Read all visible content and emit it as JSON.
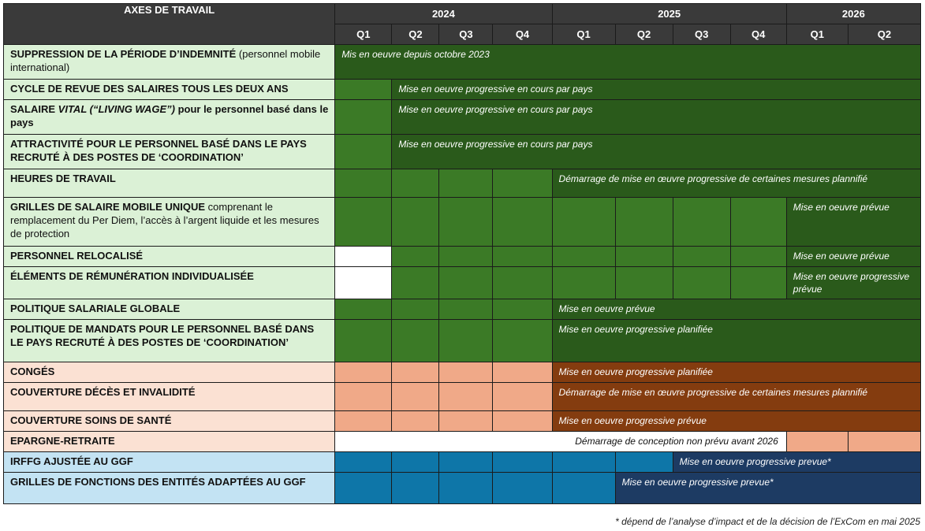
{
  "colors": {
    "header": "#3a3a3a",
    "green_label": "#dbf1d6",
    "green_cell": "#3b7a26",
    "green_note": "#2a5a1b",
    "orange_label": "#fbe1d3",
    "orange_cell": "#f0a988",
    "orange_note": "#843c0f",
    "blue_label": "#c3e3f3",
    "blue_cell": "#0e76a8",
    "blue_note": "#1d3b63",
    "empty": "#ffffff"
  },
  "header": {
    "axes_label": "AXES DE TRAVAIL",
    "years": [
      {
        "label": "2024",
        "span": 4
      },
      {
        "label": "2025",
        "span": 4
      },
      {
        "label": "2026",
        "span": 2
      }
    ],
    "quarters": [
      "Q1",
      "Q2",
      "Q3",
      "Q4",
      "Q1",
      "Q2",
      "Q3",
      "Q4",
      "Q1",
      "Q2"
    ]
  },
  "rows": [
    {
      "id": "suppression-periode-indemnite",
      "h": 44,
      "theme": "green",
      "label": [
        {
          "t": "SUPPRESSION DE LA PÉRIODE D’INDEMNITÉ",
          "b": true
        },
        {
          "t": " (personnel mobile international)",
          "b": false
        }
      ],
      "cells": [],
      "note": {
        "text": "Mis en oeuvre depuis octobre 2023",
        "start": 0
      }
    },
    {
      "id": "cycle-revue-salaires",
      "h": 26,
      "theme": "green",
      "label": [
        {
          "t": "CYCLE DE REVUE DES SALAIRES TOUS LES DEUX ANS",
          "b": true
        }
      ],
      "cells": [
        "c"
      ],
      "note": {
        "text": "Mise en oeuvre progressive en cours par pays",
        "start": 1
      }
    },
    {
      "id": "salaire-vital",
      "h": 44,
      "theme": "green",
      "label": [
        {
          "t": "SALAIRE ",
          "b": true
        },
        {
          "t": "VITAL (“LIVING WAGE”)",
          "b": true,
          "i": true
        },
        {
          "t": " pour le personnel basé dans le pays",
          "b": true
        }
      ],
      "cells": [
        "c"
      ],
      "note": {
        "text": "Mise en oeuvre progressive en cours par pays",
        "start": 1
      }
    },
    {
      "id": "attractivite-coordination",
      "h": 44,
      "theme": "green",
      "label": [
        {
          "t": "ATTRACTIVITÉ POUR LE PERSONNEL BASÉ DANS LE PAYS RECRUTÉ À DES POSTES DE ‘COORDINATION’",
          "b": true
        }
      ],
      "cells": [
        "c"
      ],
      "note": {
        "text": "Mise en oeuvre progressive en cours par pays",
        "start": 1
      }
    },
    {
      "id": "heures-de-travail",
      "h": 36,
      "theme": "green",
      "label": [
        {
          "t": "HEURES DE TRAVAIL",
          "b": true
        }
      ],
      "cells": [
        "c",
        "c",
        "c",
        "c"
      ],
      "note": {
        "text": "Démarrage de mise en œuvre progressive de certaines mesures plannifié",
        "start": 4
      }
    },
    {
      "id": "grilles-salaire-mobile",
      "h": 62,
      "theme": "green",
      "label": [
        {
          "t": "GRILLES DE SALAIRE MOBILE UNIQUE",
          "b": true
        },
        {
          "t": " comprenant le remplacement du Per Diem, l’accès à l’argent liquide et les mesures de protection",
          "b": false
        }
      ],
      "cells": [
        "c",
        "c",
        "c",
        "c",
        "c",
        "c",
        "c",
        "c"
      ],
      "note": {
        "text": "Mise en oeuvre prévue",
        "start": 8
      }
    },
    {
      "id": "personnel-relocalise",
      "h": 26,
      "theme": "green",
      "label": [
        {
          "t": "PERSONNEL RELOCALISÉ",
          "b": true
        }
      ],
      "cells": [
        "e",
        "c",
        "c",
        "c",
        "c",
        "c",
        "c",
        "c"
      ],
      "note": {
        "text": "Mise en oeuvre prévue",
        "start": 8
      }
    },
    {
      "id": "remuneration-individualisee",
      "h": 41,
      "theme": "green",
      "label": [
        {
          "t": "ÉLÉMENTS DE RÉMUNÉRATION INDIVIDUALISÉE",
          "b": true
        }
      ],
      "cells": [
        "e",
        "c",
        "c",
        "c",
        "c",
        "c",
        "c",
        "c"
      ],
      "note": {
        "text": "Mise en oeuvre progressive prévue",
        "start": 8
      }
    },
    {
      "id": "politique-salariale-globale",
      "h": 26,
      "theme": "green",
      "label": [
        {
          "t": "POLITIQUE SALARIALE GLOBALE",
          "b": true
        }
      ],
      "cells": [
        "c",
        "c",
        "c",
        "c"
      ],
      "note": {
        "text": "Mise en oeuvre prévue",
        "start": 4
      }
    },
    {
      "id": "politique-mandats",
      "h": 54,
      "theme": "green",
      "label": [
        {
          "t": "POLITIQUE DE MANDATS POUR LE PERSONNEL BASÉ DANS LE PAYS RECRUTÉ À DES POSTES DE ‘COORDINATION’",
          "b": true
        }
      ],
      "cells": [
        "c",
        "c",
        "c",
        "c"
      ],
      "note": {
        "text": "Mise en oeuvre progressive planifiée",
        "start": 4
      }
    },
    {
      "id": "conges",
      "h": 26,
      "theme": "orange",
      "label": [
        {
          "t": "CONGÉS",
          "b": true
        }
      ],
      "cells": [
        "c",
        "c",
        "c",
        "c"
      ],
      "note": {
        "text": "Mise en oeuvre progressive planifiée",
        "start": 4
      }
    },
    {
      "id": "couverture-deces-invalidite",
      "h": 36,
      "theme": "orange",
      "label": [
        {
          "t": "COUVERTURE DÉCÈS ET INVALIDITÉ",
          "b": true
        }
      ],
      "cells": [
        "c",
        "c",
        "c",
        "c"
      ],
      "note": {
        "text": "Démarrage de mise en œuvre progressive de certaines mesures plannifié",
        "start": 4
      }
    },
    {
      "id": "couverture-soins-sante",
      "h": 26,
      "theme": "orange",
      "label": [
        {
          "t": "COUVERTURE SOINS DE SANTÉ",
          "b": true
        }
      ],
      "cells": [
        "c",
        "c",
        "c",
        "c"
      ],
      "note": {
        "text": "Mise en oeuvre progressive prévue",
        "start": 4
      }
    },
    {
      "id": "epargne-retraite",
      "h": 26,
      "theme": "orange",
      "label": [
        {
          "t": "EPARGNE-RETRAITE",
          "b": true
        }
      ],
      "cells": [],
      "note": {
        "text": "Démarrage de conception non prévu avant 2026",
        "start": 0,
        "span": 8,
        "blank": true
      },
      "tail": [
        "c",
        "c"
      ]
    },
    {
      "id": "irffg-ajustee-ggf",
      "h": 26,
      "theme": "blue",
      "label": [
        {
          "t": "IRFFG AJUSTÉE AU GGF",
          "b": true
        }
      ],
      "cells": [
        "c",
        "c",
        "c",
        "c",
        "c",
        "c"
      ],
      "note": {
        "text": "Mise en oeuvre progressive prevue*",
        "start": 6
      }
    },
    {
      "id": "grilles-fonctions-entites",
      "h": 40,
      "theme": "blue",
      "label": [
        {
          "t": "GRILLES DE FONCTIONS DES ENTITÉS ADAPTÉES AU GGF",
          "b": true
        }
      ],
      "cells": [
        "c",
        "c",
        "c",
        "c",
        "c"
      ],
      "note": {
        "text": "Mise en oeuvre progressive prevue*",
        "start": 5
      }
    }
  ],
  "footnote": "* dépend de l’analyse d’impact et de la décision de l’ExCom en mai 2025"
}
